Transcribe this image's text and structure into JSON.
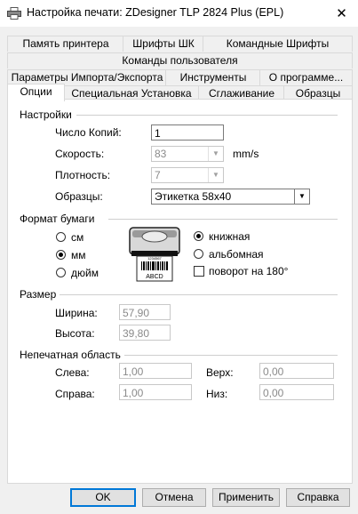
{
  "window": {
    "title": "Настройка печати: ZDesigner TLP 2824 Plus (EPL)",
    "close_glyph": "✕"
  },
  "tabs": {
    "row1": [
      "Память принтера",
      "Шрифты ШК",
      "Командные Шрифты"
    ],
    "row2": [
      "Команды пользователя"
    ],
    "row3": [
      "Параметры Импорта/Экспорта",
      "Инструменты",
      "О программе..."
    ],
    "row4": [
      "Опции",
      "Специальная Установка",
      "Сглаживание",
      "Образцы"
    ],
    "active": "Опции"
  },
  "settings": {
    "group_title": "Настройки",
    "copies_label": "Число Копий:",
    "copies_value": "1",
    "speed_label": "Скорость:",
    "speed_value": "83",
    "speed_unit": "mm/s",
    "density_label": "Плотность:",
    "density_value": "7",
    "samples_label": "Образцы:",
    "samples_value": "Этикетка 58x40"
  },
  "paper": {
    "group_title": "Формат бумаги",
    "unit_cm": "см",
    "unit_mm": "мм",
    "unit_inch": "дюйм",
    "selected_unit": "мм",
    "orientation_portrait": "книжная",
    "orientation_landscape": "альбомная",
    "selected_orientation": "книжная",
    "rotate_label": "поворот на 180°",
    "preview_text": "ABCD",
    "preview_number": "1234567"
  },
  "size": {
    "group_title": "Размер",
    "width_label": "Ширина:",
    "width_value": "57,90",
    "height_label": "Высота:",
    "height_value": "39,80"
  },
  "nonprint": {
    "group_title": "Непечатная область",
    "left_label": "Слева:",
    "left_value": "1,00",
    "top_label": "Верх:",
    "top_value": "0,00",
    "right_label": "Справа:",
    "right_value": "1,00",
    "bottom_label": "Низ:",
    "bottom_value": "0,00"
  },
  "buttons": {
    "ok": "OK",
    "cancel": "Отмена",
    "apply": "Применить",
    "help": "Справка"
  }
}
